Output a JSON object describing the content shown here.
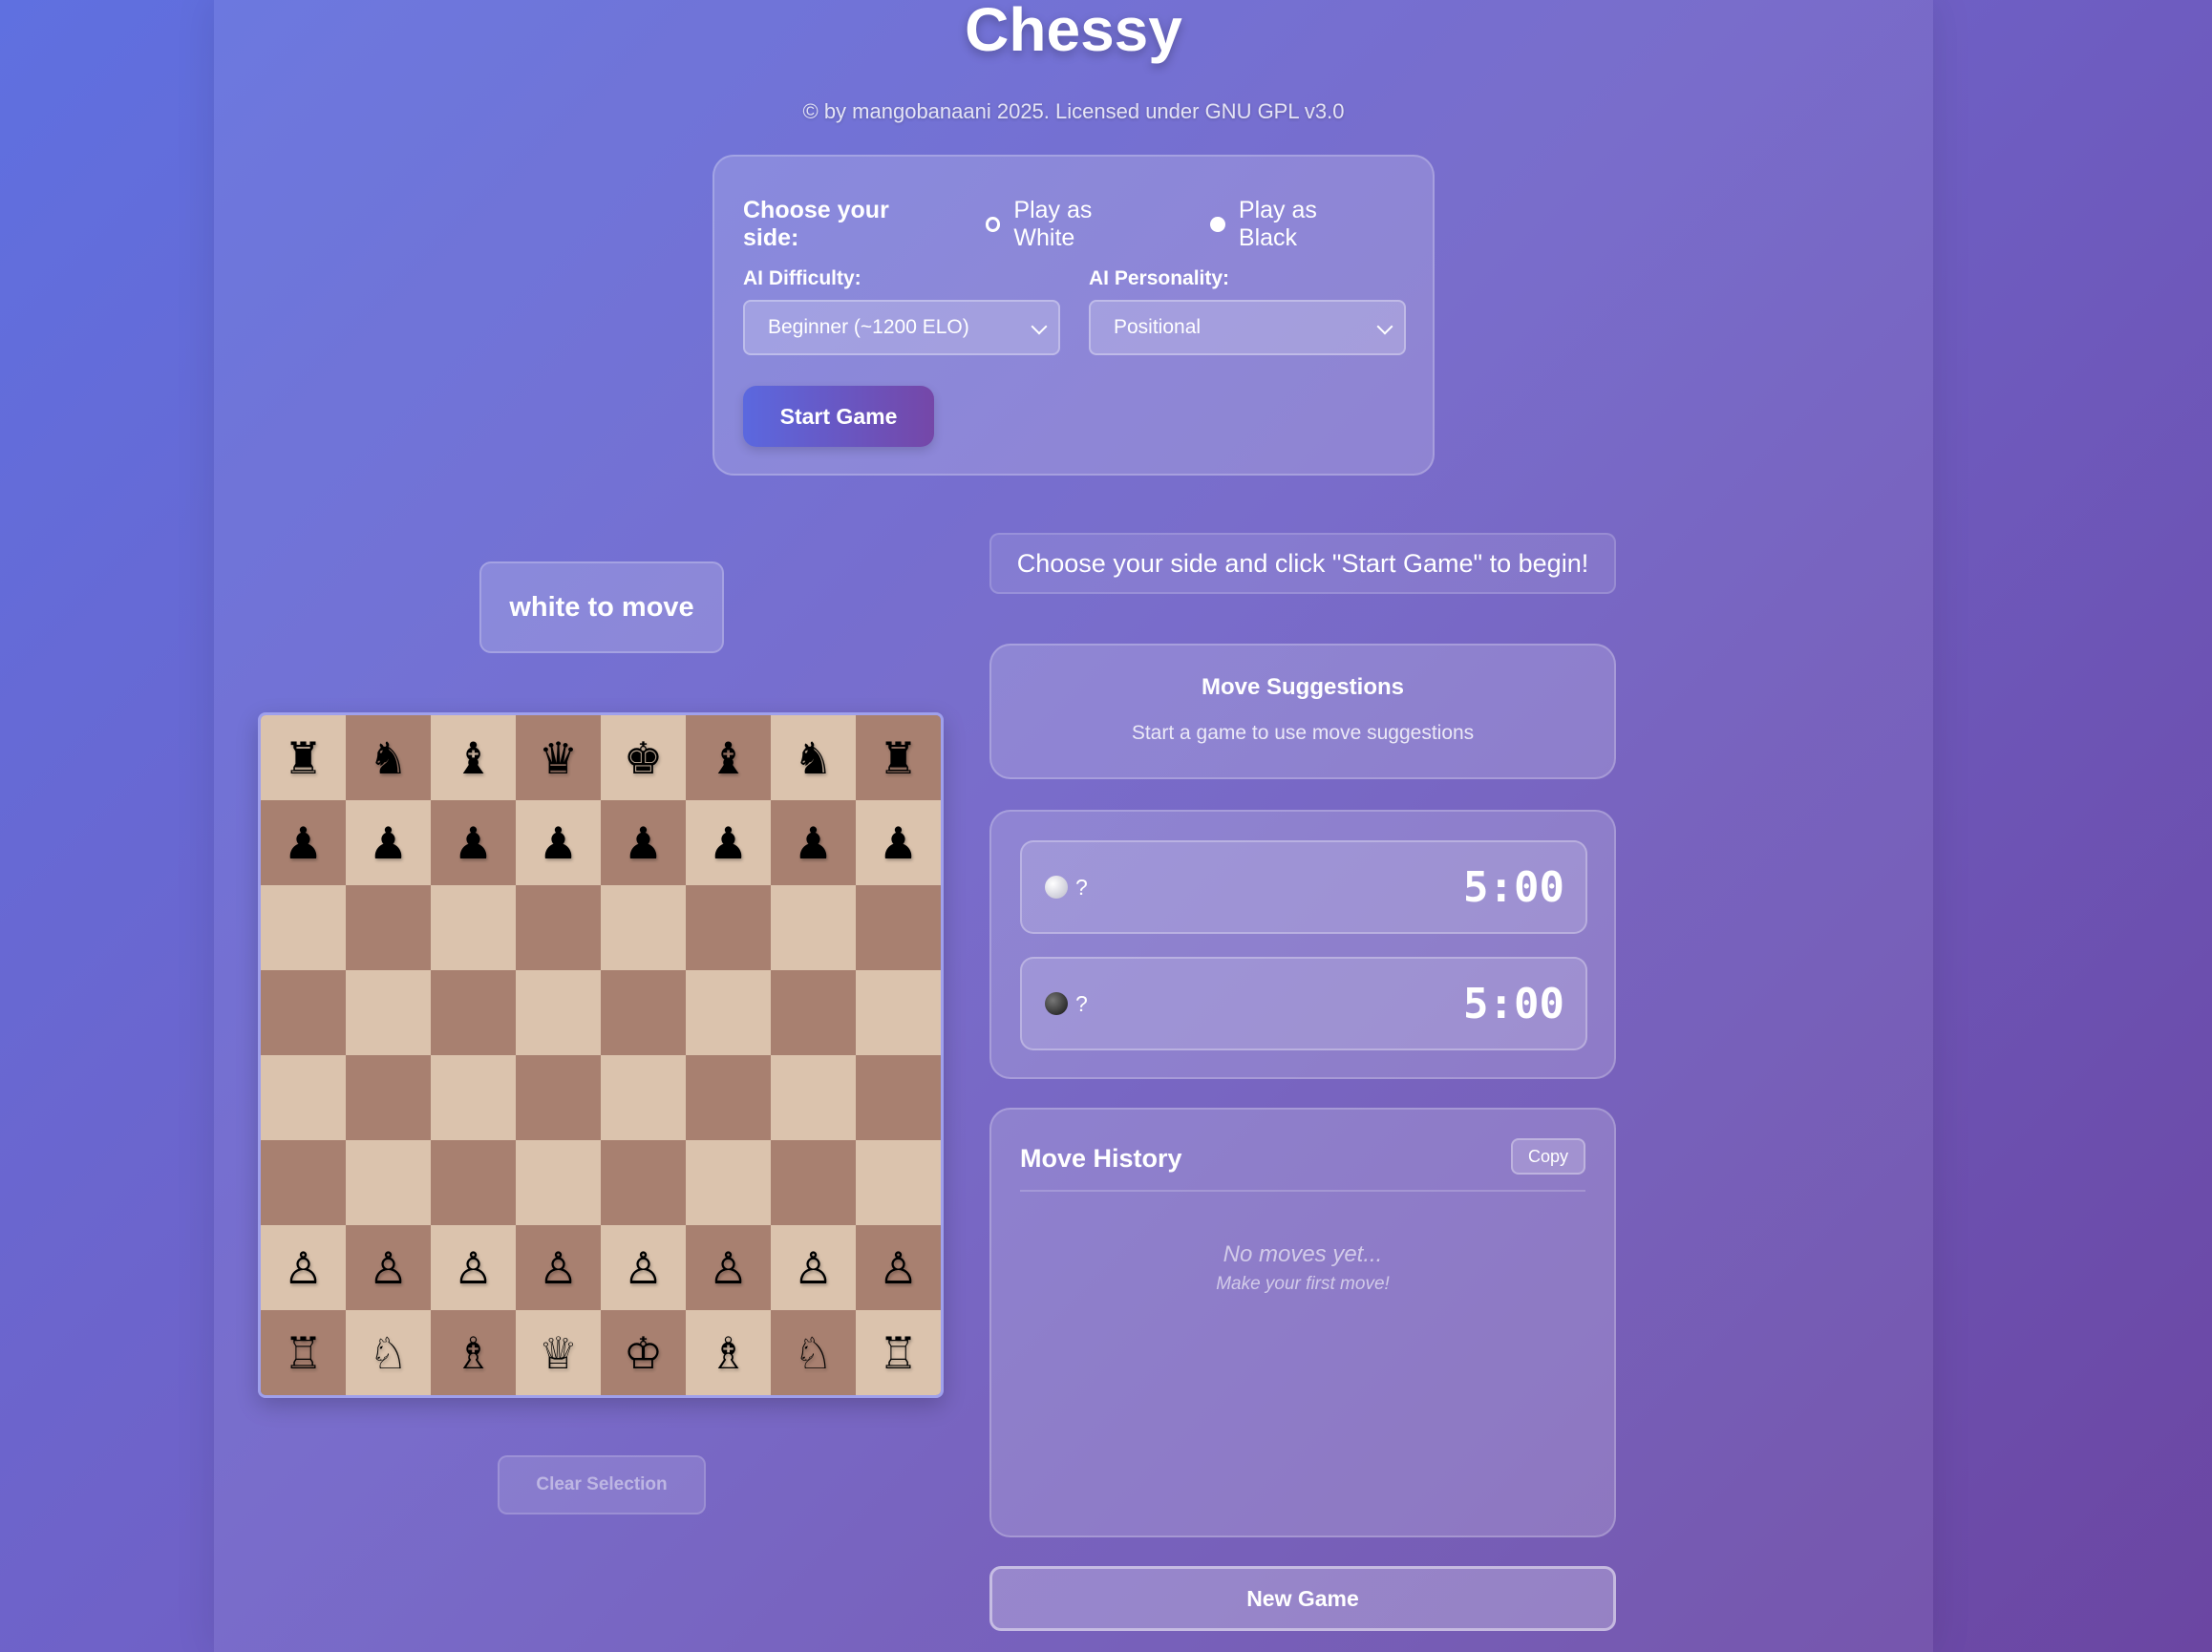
{
  "app": {
    "title": "Chessy",
    "copyright": "© by mangobanaani 2025. Licensed under GNU GPL v3.0"
  },
  "setup": {
    "side_label": "Choose your side:",
    "side_options": [
      {
        "label": "Play as White",
        "selected": false
      },
      {
        "label": "Play as Black",
        "selected": true
      }
    ],
    "difficulty_label": "AI Difficulty:",
    "difficulty_value": "Beginner (~1200 ELO)",
    "personality_label": "AI Personality:",
    "personality_value": "Positional",
    "start_button": "Start Game"
  },
  "turn_indicator": "white to move",
  "board": {
    "light_color": "#dbc3ad",
    "dark_color": "#a88070",
    "rows": [
      [
        "♜",
        "♞",
        "♝",
        "♛",
        "♚",
        "♝",
        "♞",
        "♜"
      ],
      [
        "♟",
        "♟",
        "♟",
        "♟",
        "♟",
        "♟",
        "♟",
        "♟"
      ],
      [
        "",
        "",
        "",
        "",
        "",
        "",
        "",
        ""
      ],
      [
        "",
        "",
        "",
        "",
        "",
        "",
        "",
        ""
      ],
      [
        "",
        "",
        "",
        "",
        "",
        "",
        "",
        ""
      ],
      [
        "",
        "",
        "",
        "",
        "",
        "",
        "",
        ""
      ],
      [
        "♙",
        "♙",
        "♙",
        "♙",
        "♙",
        "♙",
        "♙",
        "♙"
      ],
      [
        "♖",
        "♘",
        "♗",
        "♕",
        "♔",
        "♗",
        "♘",
        "♖"
      ]
    ]
  },
  "clear_selection_button": "Clear Selection",
  "status_message": "Choose your side and click \"Start Game\" to begin!",
  "suggestions": {
    "title": "Move Suggestions",
    "subtitle": "Start a game to use move suggestions"
  },
  "clocks": {
    "white": {
      "player": "?",
      "time": "5:00"
    },
    "black": {
      "player": "?",
      "time": "5:00"
    }
  },
  "history": {
    "title": "Move History",
    "copy_button": "Copy",
    "empty_line1": "No moves yet...",
    "empty_line2": "Make your first move!"
  },
  "new_game_button": "New Game"
}
